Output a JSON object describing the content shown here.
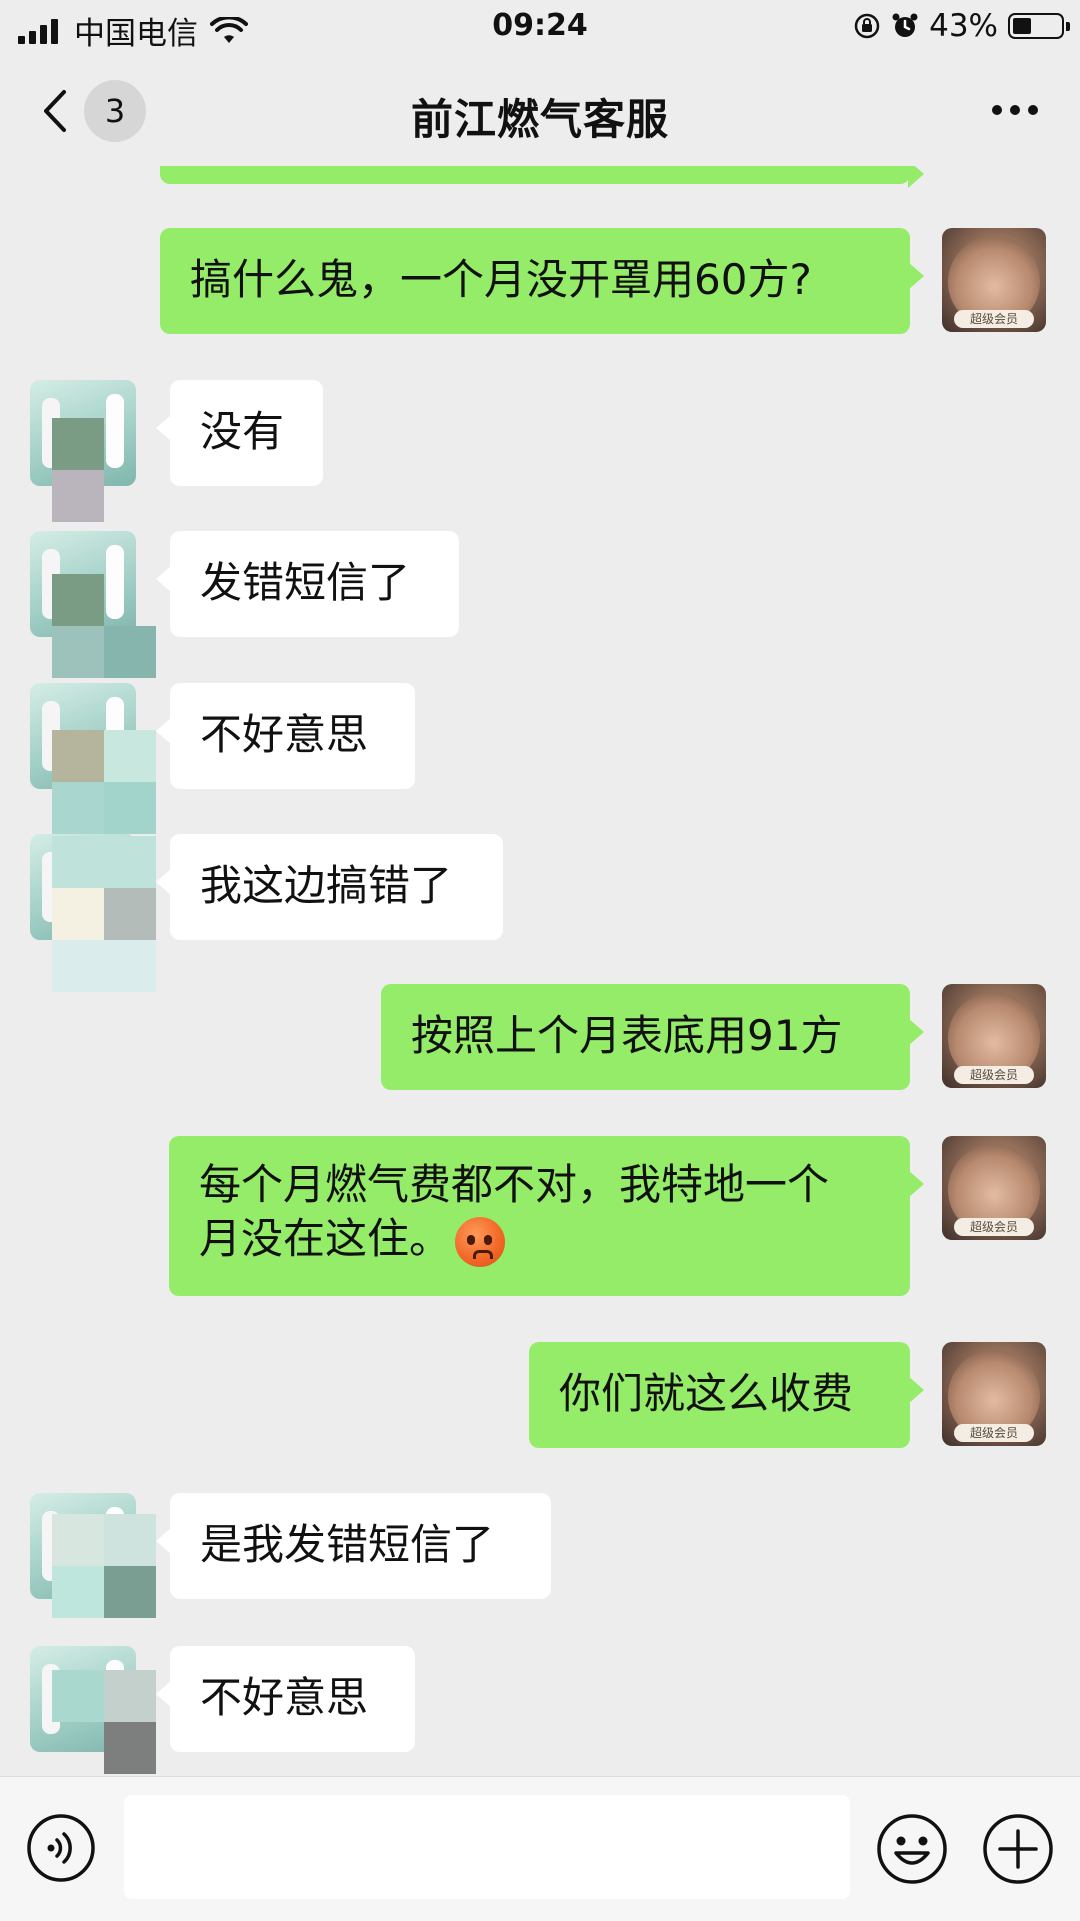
{
  "status_bar": {
    "carrier": "中国电信",
    "time": "09:24",
    "battery": "43%"
  },
  "nav": {
    "unread_count": "3",
    "title": "前江燃气客服"
  },
  "messages": [
    {
      "side": "out",
      "text": "搞什么鬼，一个月没开罩用60方?"
    },
    {
      "side": "in",
      "text": "没有"
    },
    {
      "side": "in",
      "text": "发错短信了"
    },
    {
      "side": "in",
      "text": "不好意思"
    },
    {
      "side": "in",
      "text": "我这边搞错了"
    },
    {
      "side": "out",
      "text": "按照上个月表底用91方"
    },
    {
      "side": "out",
      "line1": "每个月燃气费都不对，我特地一个",
      "line2": "月没在这住。",
      "emoji": "anxious-sweat-face-emoji"
    },
    {
      "side": "out",
      "text": "你们就这么收费"
    },
    {
      "side": "in",
      "text": "是我发错短信了"
    },
    {
      "side": "in",
      "text": "不好意思"
    }
  ],
  "avatar_badge": "超级会员",
  "input": {
    "value": "",
    "placeholder": ""
  },
  "icons": {
    "back": "chevron-left-icon",
    "more": "ellipsis-icon",
    "voice": "voice-icon",
    "emoji": "smiley-icon",
    "plus": "plus-icon"
  },
  "colors": {
    "outgoing_bubble": "#95ec69",
    "incoming_bubble": "#ffffff",
    "background": "#ededed"
  }
}
